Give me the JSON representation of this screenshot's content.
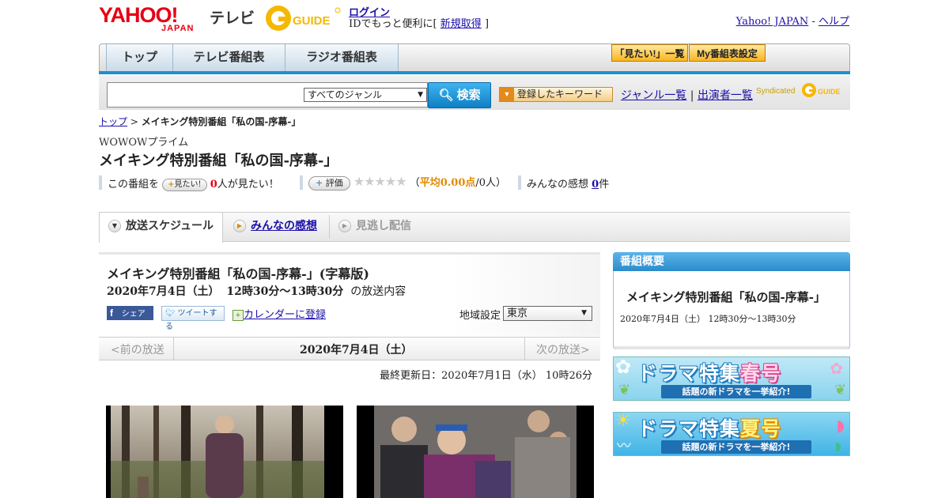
{
  "header": {
    "logo_yahoo": "YAHOO!",
    "logo_japan": "JAPAN",
    "logo_tv": "テレビ",
    "gguide": "G-GUIDE",
    "login": "ログイン",
    "login_sub_pre": "IDでもっと便利に[",
    "signup": "新規取得",
    "login_sub_post": "]",
    "yahoo_japan": "Yahoo! JAPAN",
    "sep": "-",
    "help": "ヘルプ"
  },
  "nav": {
    "tabs": [
      "トップ",
      "テレビ番組表",
      "ラジオ番組表"
    ],
    "wishlist": "「見たい!」一覧",
    "my_schedule": "My番組表設定"
  },
  "search": {
    "genre_selected": "すべてのジャンル",
    "button": "検索",
    "keyword": "登録したキーワード",
    "genre_list": "ジャンル一覧",
    "divider": "|",
    "cast_list": "出演者一覧",
    "syndicated": "Syndicated"
  },
  "breadcrumb": {
    "top": "トップ",
    "sep": ">",
    "current": "メイキング特別番組「私の国-序幕-」"
  },
  "program": {
    "channel": "WOWOWプライム",
    "title": "メイキング特別番組「私の国-序幕-」",
    "watch_pre": "この番組を",
    "watch_pill": "見たい!",
    "watch_count": "0",
    "watch_post": "人が見たい！",
    "rate_pill": "評価",
    "stars": "★★★★★",
    "avg_open": "（",
    "avg_label": "平均0.00点",
    "avg_count": "/0人）",
    "comments_label": "みんなの感想",
    "comments_count": "0",
    "comments_unit": "件"
  },
  "tabs": {
    "schedule": "放送スケジュール",
    "comments": "みんなの感想",
    "vod": "見逃し配信"
  },
  "episode": {
    "title": "メイキング特別番組「私の国-序幕-」(字幕版)",
    "date": "2020年7月4日（土）",
    "time": "12時30分～13時30分",
    "suffix": "の放送内容",
    "fb": "シェア",
    "tweet": "ツイートする",
    "calendar": "カレンダーに登録",
    "region_label": "地域設定",
    "region": "東京",
    "prev": "<前の放送",
    "current_date": "2020年7月4日（土）",
    "next": "次の放送>",
    "updated": "最終更新日：2020年7月1日（水） 10時26分"
  },
  "sidebar": {
    "header": "番組概要",
    "title": "メイキング特別番組「私の国-序幕-」",
    "date": "2020年7月4日（土） 12時30分～13時30分",
    "spring_main_a": "ドラマ特集",
    "spring_main_b": "春号",
    "spring_sub": "話題の新ドラマを一挙紹介!",
    "summer_main_a": "ドラマ特集",
    "summer_main_b": "夏号",
    "summer_sub": "話題の新ドラマを一挙紹介!"
  },
  "colors": {
    "brand_red": "#e60012",
    "nav_blue": "#1e8fd0",
    "accent_orange": "#e08a00"
  }
}
